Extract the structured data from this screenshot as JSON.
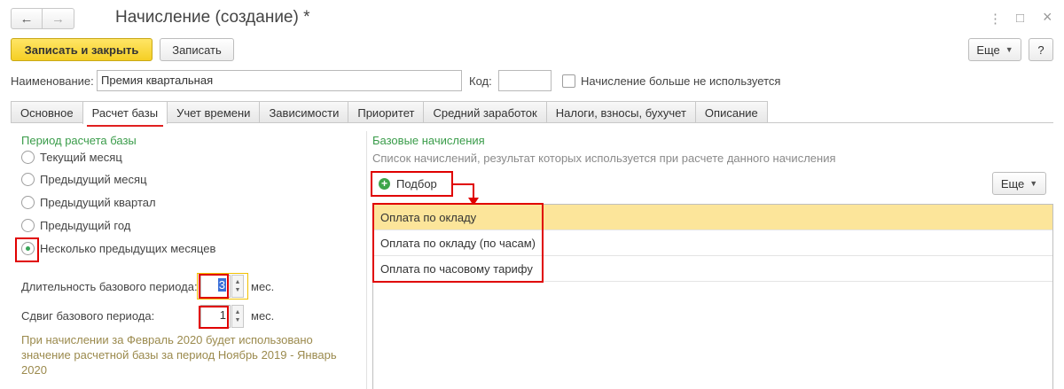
{
  "window": {
    "title": "Начисление (создание) *",
    "nav_back_icon": "←",
    "nav_forward_icon": "→",
    "more_icon": "⋮",
    "maximize_icon": "□",
    "close_icon": "×"
  },
  "toolbar": {
    "save_close_label": "Записать и закрыть",
    "save_label": "Записать",
    "more_label": "Еще",
    "help_label": "?"
  },
  "header": {
    "name_label": "Наименование:",
    "name_value": "Премия квартальная",
    "code_label": "Код:",
    "code_value": "",
    "unused_label": "Начисление больше не используется"
  },
  "tabs": [
    {
      "label": "Основное"
    },
    {
      "label": "Расчет базы"
    },
    {
      "label": "Учет времени"
    },
    {
      "label": "Зависимости"
    },
    {
      "label": "Приоритет"
    },
    {
      "label": "Средний заработок"
    },
    {
      "label": "Налоги, взносы, бухучет"
    },
    {
      "label": "Описание"
    }
  ],
  "period": {
    "title": "Период расчета базы",
    "options": [
      {
        "label": "Текущий месяц",
        "selected": false
      },
      {
        "label": "Предыдущий месяц",
        "selected": false
      },
      {
        "label": "Предыдущий квартал",
        "selected": false
      },
      {
        "label": "Предыдущий год",
        "selected": false
      },
      {
        "label": "Несколько предыдущих месяцев",
        "selected": true
      }
    ],
    "duration_label": "Длительность базового периода:",
    "duration_value": "3",
    "duration_unit": "мес.",
    "shift_label": "Сдвиг базового периода:",
    "shift_value": "1",
    "shift_unit": "мес.",
    "hint": "При начислении за Февраль 2020 будет использовано значение расчетной базы за период Ноябрь 2019 - Январь 2020"
  },
  "base": {
    "title": "Базовые начисления",
    "description": "Список начислений, результат которых используется при расчете данного начисления",
    "pick_label": "Подбор",
    "more_label": "Еще",
    "rows": [
      {
        "label": "Оплата по окладу"
      },
      {
        "label": "Оплата по окладу (по часам)"
      },
      {
        "label": "Оплата по часовому тарифу"
      }
    ]
  },
  "colors": {
    "accent_yellow": "#f5cf24",
    "highlight_red": "#e00000",
    "green": "#3a9c4a",
    "selected_row": "#fce59a"
  }
}
